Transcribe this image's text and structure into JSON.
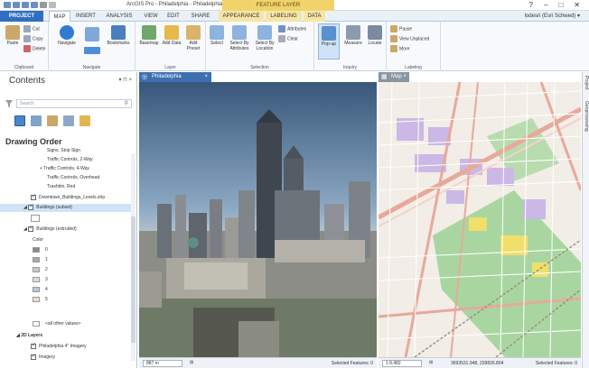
{
  "titlebar": {
    "app_title": "ArcGIS Pro - Philadelphia - Philadelphia",
    "context_tab": "FEATURE LAYER",
    "help": "?",
    "minimize": "–",
    "maximize": "□",
    "close": "✕"
  },
  "ribbon_tabs": {
    "project": "PROJECT",
    "map": "MAP",
    "insert": "INSERT",
    "analysis": "ANALYSIS",
    "view": "VIEW",
    "edit": "EDIT",
    "share": "SHARE",
    "appearance": "APPEARANCE",
    "labeling": "LABELING",
    "data": "DATA",
    "user": "lodesri (Esri Schwed) ▾"
  },
  "ribbon": {
    "clipboard": {
      "label": "Clipboard",
      "paste": "Paste",
      "cut": "Cut",
      "copy": "Copy",
      "delete": "Delete"
    },
    "navigate": {
      "label": "Navigate",
      "navigate": "Navigate",
      "bookmarks": "Bookmarks"
    },
    "layer": {
      "label": "Layer",
      "basemap": "Basemap",
      "add_data": "Add Data",
      "add_preset": "Add Preset"
    },
    "selection": {
      "label": "Selection",
      "select": "Select",
      "select_by_attributes": "Select By Attributes",
      "select_by_location": "Select By Location",
      "attributes": "Attributes",
      "clear": "Clear"
    },
    "inquiry": {
      "label": "Inquiry",
      "popup": "Pop-up",
      "measure": "Measure",
      "locate": "Locate"
    },
    "labeling": {
      "label": "Labeling",
      "pause": "Pause",
      "view_unplaced": "View Unplaced",
      "more": "More"
    }
  },
  "contents": {
    "title": "Contents",
    "pin": "▾ ⊓ ×",
    "search_placeholder": "Search",
    "drawing_order": "Drawing Order",
    "items": [
      {
        "label": "Signs, Stop Sign"
      },
      {
        "label": "Traffic Controls, 2-Way"
      },
      {
        "label": "Traffic Controls, 4-Way"
      },
      {
        "label": "Traffic Controls, Overhead"
      },
      {
        "label": "Trashbin, Red"
      },
      {
        "label": "Downtown_Buildings_Levels.shp"
      },
      {
        "label": "Buildings (subset)"
      },
      {
        "label": "Buildings (extruded)"
      },
      {
        "label": "Color"
      },
      {
        "label": "0"
      },
      {
        "label": "1"
      },
      {
        "label": "2"
      },
      {
        "label": "3"
      },
      {
        "label": "4"
      },
      {
        "label": "5"
      },
      {
        "label": "<all other values>"
      },
      {
        "label": "2D Layers"
      },
      {
        "label": "Philadelphia 4\" Imagery"
      },
      {
        "label": "Imagery"
      }
    ]
  },
  "scene_view": {
    "tab": "Philadelphia",
    "scale": "887 m",
    "selected_features": "Selected Features: 0"
  },
  "map_view": {
    "tab": "Map",
    "scale": "1:9,482",
    "coords": "3693531.948, 239826.804",
    "selected_features": "Selected Features: 0"
  },
  "side_panel": {
    "project": "Project",
    "geoprocessing": "Geoprocessing"
  },
  "colors": {
    "project_tab": "#2f6fbf",
    "context_tab": "#f2d36b",
    "selected_row": "#cfe3f8",
    "swatch_0": "#8a8a8a",
    "swatch_1": "#a9a9a9",
    "swatch_2": "#c8c8c8",
    "swatch_3": "#dcdcdc",
    "swatch_4": "#b4c8d8",
    "swatch_5": "#e8e0d0"
  }
}
